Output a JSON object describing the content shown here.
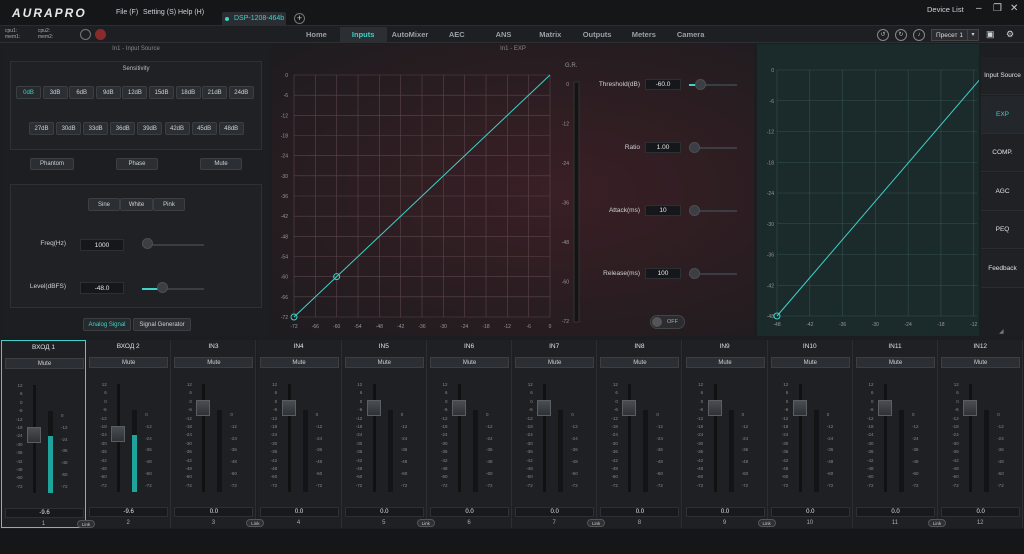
{
  "app": {
    "logo": "AURAPRO",
    "menu": [
      "File (F)",
      "Setting (S)",
      "Help (H)"
    ],
    "device_tab": "DSP-1208-464b",
    "device_list": "Device List",
    "cpu1": "cpu1:",
    "mem1": "mem1:",
    "cpu2": "cpu2:",
    "mem2": "mem2:"
  },
  "tabs": [
    "Home",
    "Inputs",
    "AutoMixer",
    "AEC",
    "ANS",
    "Matrix",
    "Outputs",
    "Meters",
    "Camera"
  ],
  "active_tab": "Inputs",
  "preset": "Пресет 1",
  "input_source": {
    "title": "In1 - Input Source",
    "sensitivity_label": "Sensitivity",
    "row1": [
      "0dB",
      "3dB",
      "6dB",
      "9dB",
      "12dB",
      "15dB",
      "18dB",
      "21dB",
      "24dB"
    ],
    "row2": [
      "27dB",
      "30dB",
      "33dB",
      "36dB",
      "39dB",
      "42dB",
      "45dB",
      "48dB"
    ],
    "selected": "0dB",
    "phantom": "Phantom",
    "phase": "Phase",
    "mute": "Mute",
    "wave": [
      "Sine",
      "White",
      "Pink"
    ],
    "freq_label": "Freq(Hz)",
    "freq_value": "1000",
    "level_label": "Level(dBFS)",
    "level_value": "-48.0",
    "mode_tabs": [
      "Analog Signal",
      "Signal Generator"
    ]
  },
  "exp": {
    "title": "In1 - EXP",
    "gr_label": "G.R.",
    "y_ticks": [
      "0",
      "-6",
      "-12",
      "-18",
      "-24",
      "-30",
      "-36",
      "-42",
      "-48",
      "-54",
      "-60",
      "-66",
      "-72"
    ],
    "x_ticks": [
      "-72",
      "-66",
      "-60",
      "-54",
      "-48",
      "-42",
      "-36",
      "-30",
      "-24",
      "-18",
      "-12",
      "-6",
      "0"
    ],
    "gr_ticks": [
      "0",
      "-12",
      "-24",
      "-36",
      "-48",
      "-60",
      "-72"
    ],
    "threshold_label": "Threshold(dB)",
    "threshold_value": "-60.0",
    "ratio_label": "Ratio",
    "ratio_value": "1.00",
    "attack_label": "Attack(ms)",
    "attack_value": "10",
    "release_label": "Release(ms)",
    "release_value": "100",
    "toggle": "OFF"
  },
  "graph2": {
    "y_ticks": [
      "0",
      "-6",
      "-12",
      "-18",
      "-24",
      "-30",
      "-36",
      "-42",
      "-48"
    ],
    "x_ticks": [
      "-48",
      "-42",
      "-36",
      "-30",
      "-24",
      "-18",
      "-12"
    ]
  },
  "sidebar": [
    "Input Source",
    "EXP",
    "COMP.",
    "AGC",
    "PEQ",
    "Feedback"
  ],
  "sidebar_active": "EXP",
  "strip": {
    "mute": "Mute",
    "link": "Link",
    "fader_ticks": [
      "12",
      "6",
      "0",
      "-6",
      "-12",
      "-18",
      "-24",
      "-30",
      "-36",
      "-42",
      "-48",
      "-60",
      "-72"
    ],
    "meter_ticks": [
      "0",
      "-12",
      "-24",
      "-36",
      "-48",
      "-60",
      "-72"
    ]
  },
  "channels": [
    {
      "name": "ВХОД 1",
      "value": "-9.6",
      "num": "1",
      "level": 0.7
    },
    {
      "name": "ВХОД 2",
      "value": "-9.6",
      "num": "2",
      "level": 0.7
    },
    {
      "name": "IN3",
      "value": "0.0",
      "num": "3",
      "level": 0
    },
    {
      "name": "IN4",
      "value": "0.0",
      "num": "4",
      "level": 0
    },
    {
      "name": "IN5",
      "value": "0.0",
      "num": "5",
      "level": 0
    },
    {
      "name": "IN6",
      "value": "0.0",
      "num": "6",
      "level": 0
    },
    {
      "name": "IN7",
      "value": "0.0",
      "num": "7",
      "level": 0
    },
    {
      "name": "IN8",
      "value": "0.0",
      "num": "8",
      "level": 0
    },
    {
      "name": "IN9",
      "value": "0.0",
      "num": "9",
      "level": 0
    },
    {
      "name": "IN10",
      "value": "0.0",
      "num": "10",
      "level": 0
    },
    {
      "name": "IN11",
      "value": "0.0",
      "num": "11",
      "level": 0
    },
    {
      "name": "IN12",
      "value": "0.0",
      "num": "12",
      "level": 0
    }
  ],
  "colors": {
    "accent": "#3fd2c8"
  }
}
